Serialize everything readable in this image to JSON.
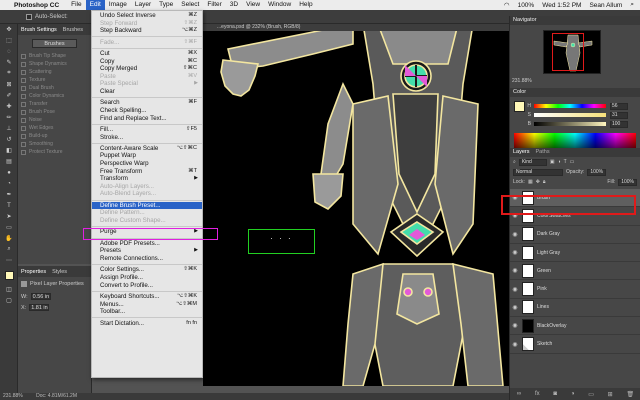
{
  "menubar": {
    "app": "Photoshop CC",
    "items": [
      "File",
      "Edit",
      "Image",
      "Layer",
      "Type",
      "Select",
      "Filter",
      "3D",
      "View",
      "Window",
      "Help"
    ],
    "active": "Edit",
    "battery": "100%",
    "clock": "Wed 1:52 PM",
    "user": "Sean Allum"
  },
  "options_bar": {
    "auto_select_label": "Auto-Select:"
  },
  "brush_panel": {
    "tabs": [
      "Brush Settings",
      "Brushes"
    ],
    "brushes_button": "Brushes",
    "options": [
      "Brush Tip Shape",
      "Shape Dynamics",
      "Scattering",
      "Texture",
      "Dual Brush",
      "Color Dynamics",
      "Transfer",
      "Brush Pose",
      "Noise",
      "Wet Edges",
      "Build-up",
      "Smoothing",
      "Protect Texture"
    ]
  },
  "properties_panel": {
    "tabs": [
      "Properties",
      "Styles"
    ],
    "title": "Pixel Layer Properties",
    "w_label": "W:",
    "w_value": "0.56 in",
    "x_label": "X:",
    "x_value": "1.81 in"
  },
  "document": {
    "tab_title": "...eyona.psd @ 232% (Brush, RGB/8)",
    "status_zoom": "231.88%",
    "status_doc": "Doc: 4.81M/61.2M"
  },
  "edit_menu": {
    "items": [
      {
        "label": "Undo Select Inverse",
        "shortcut": "⌘Z",
        "disabled": false
      },
      {
        "label": "Step Forward",
        "shortcut": "⇧⌘Z",
        "disabled": true
      },
      {
        "label": "Step Backward",
        "shortcut": "⌥⌘Z",
        "disabled": false
      },
      {
        "sep": true
      },
      {
        "label": "Fade...",
        "shortcut": "⇧⌘F",
        "disabled": true
      },
      {
        "sep": true
      },
      {
        "label": "Cut",
        "shortcut": "⌘X",
        "disabled": false
      },
      {
        "label": "Copy",
        "shortcut": "⌘C",
        "disabled": false
      },
      {
        "label": "Copy Merged",
        "shortcut": "⇧⌘C",
        "disabled": false
      },
      {
        "label": "Paste",
        "shortcut": "⌘V",
        "disabled": true
      },
      {
        "label": "Paste Special",
        "submenu": true,
        "disabled": true
      },
      {
        "label": "Clear",
        "disabled": false
      },
      {
        "sep": true
      },
      {
        "label": "Search",
        "shortcut": "⌘F",
        "disabled": false
      },
      {
        "label": "Check Spelling...",
        "disabled": false
      },
      {
        "label": "Find and Replace Text...",
        "disabled": false
      },
      {
        "sep": true
      },
      {
        "label": "Fill...",
        "shortcut": "⇧F5",
        "disabled": false
      },
      {
        "label": "Stroke...",
        "disabled": false
      },
      {
        "sep": true
      },
      {
        "label": "Content-Aware Scale",
        "shortcut": "⌥⇧⌘C",
        "disabled": false
      },
      {
        "label": "Puppet Warp",
        "disabled": false
      },
      {
        "label": "Perspective Warp",
        "disabled": false
      },
      {
        "label": "Free Transform",
        "shortcut": "⌘T",
        "disabled": false
      },
      {
        "label": "Transform",
        "submenu": true,
        "disabled": false
      },
      {
        "label": "Auto-Align Layers...",
        "disabled": true
      },
      {
        "label": "Auto-Blend Layers...",
        "disabled": true
      },
      {
        "sep": true
      },
      {
        "label": "Define Brush Preset...",
        "disabled": false,
        "highlighted": true
      },
      {
        "label": "Define Pattern...",
        "disabled": true
      },
      {
        "label": "Define Custom Shape...",
        "disabled": true
      },
      {
        "sep": true
      },
      {
        "label": "Purge",
        "submenu": true,
        "disabled": false
      },
      {
        "sep": true
      },
      {
        "label": "Adobe PDF Presets...",
        "disabled": false
      },
      {
        "label": "Presets",
        "submenu": true,
        "disabled": false
      },
      {
        "label": "Remote Connections...",
        "disabled": false
      },
      {
        "sep": true
      },
      {
        "label": "Color Settings...",
        "shortcut": "⇧⌘K",
        "disabled": false
      },
      {
        "label": "Assign Profile...",
        "disabled": false
      },
      {
        "label": "Convert to Profile...",
        "disabled": false
      },
      {
        "sep": true
      },
      {
        "label": "Keyboard Shortcuts...",
        "shortcut": "⌥⇧⌘K",
        "disabled": false
      },
      {
        "label": "Menus...",
        "shortcut": "⌥⇧⌘M",
        "disabled": false
      },
      {
        "label": "Toolbar...",
        "disabled": false
      },
      {
        "sep": true
      },
      {
        "label": "Start Dictation...",
        "shortcut": "fn fn",
        "disabled": false
      }
    ]
  },
  "canvas_box_text": "· · ·",
  "navigator": {
    "title": "Navigator",
    "zoom": "231.88%"
  },
  "color_panel": {
    "title": "Color",
    "sliders": [
      {
        "label": "H",
        "value": "56",
        "colors": [
          "#f00",
          "#ff0",
          "#0f0",
          "#0ff",
          "#00f",
          "#f0f",
          "#f00"
        ]
      },
      {
        "label": "S",
        "value": "31",
        "colors": [
          "#fff",
          "#f5e07a"
        ]
      },
      {
        "label": "B",
        "value": "100",
        "colors": [
          "#000",
          "#fff6c0"
        ]
      }
    ],
    "fg_color": "#fff8b8",
    "accent": "#2a63c7"
  },
  "layers_panel": {
    "tabs": [
      "Layers",
      "Paths"
    ],
    "kind_label": "Kind",
    "blend_mode": "Normal",
    "opacity_label": "Opacity:",
    "opacity": "100%",
    "lock_label": "Lock:",
    "fill_label": "Fill:",
    "fill": "100%",
    "layers": [
      {
        "name": "Brush",
        "selected": true,
        "thumb": "white"
      },
      {
        "name": "ColorSwatches",
        "selected": false,
        "thumb": "white"
      },
      {
        "name": "Dark Gray",
        "selected": false,
        "thumb": "white"
      },
      {
        "name": "Light Gray",
        "selected": false,
        "thumb": "white"
      },
      {
        "name": "Green",
        "selected": false,
        "thumb": "white"
      },
      {
        "name": "Pink",
        "selected": false,
        "thumb": "white"
      },
      {
        "name": "Lines",
        "selected": false,
        "thumb": "white"
      },
      {
        "name": "BlackOverlay",
        "selected": false,
        "thumb": "black"
      },
      {
        "name": "Sketch",
        "selected": false,
        "thumb": "sketch"
      }
    ]
  },
  "annotation_colors": {
    "magenta": "#e020e0",
    "green": "#22d022",
    "red": "#e01a1a"
  }
}
